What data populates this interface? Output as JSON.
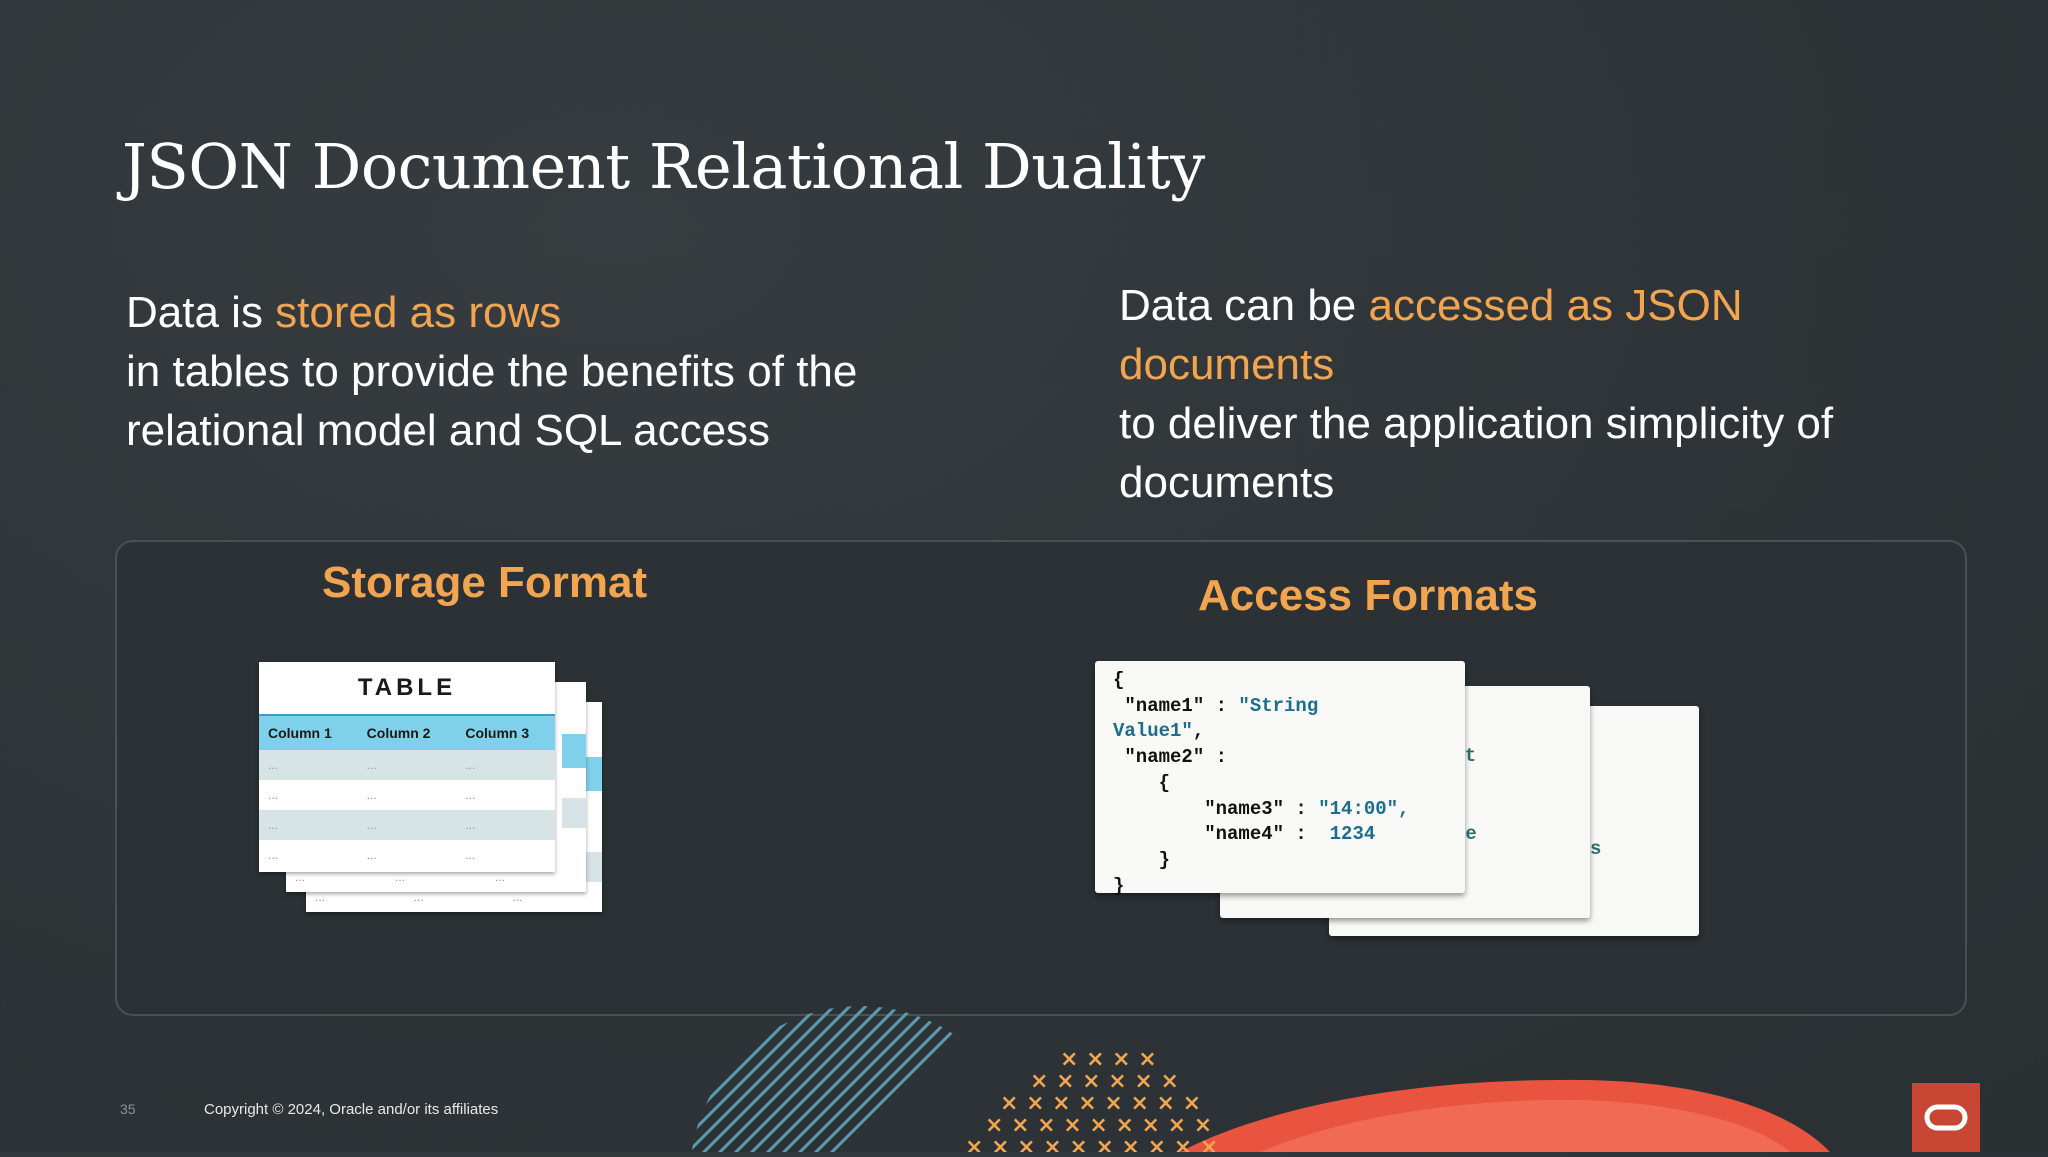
{
  "slide": {
    "title": "JSON Document Relational Duality",
    "left_text": {
      "intro": "Data is ",
      "highlight": "stored as rows",
      "line2": "in tables to provide the benefits of the",
      "line3": "relational model and SQL access"
    },
    "right_text": {
      "intro": "Data can be ",
      "highlight1": "accessed as JSON",
      "highlight2": "documents",
      "line3": "to deliver the application simplicity of",
      "line4": "documents"
    },
    "storage_title": "Storage Format",
    "access_title": "Access Formats",
    "table": {
      "title": "TABLE",
      "columns": [
        "Column 1",
        "Column 2",
        "Column 3"
      ],
      "cell": "..."
    },
    "json": {
      "open_brace": "{",
      "name1_key": " \"name1\" : ",
      "name1_val_a": "\"String",
      "name1_val_b": "Value1\"",
      "comma": ",",
      "name2_key": " \"name2\" :",
      "inner_open": "    {",
      "name3_key": "        \"name3\" : ",
      "name3_val": "\"14:00\",",
      "name4_key": "        \"name4\" :  ",
      "name4_val": "1234",
      "inner_close": "    }",
      "close_brace": "}",
      "peek1": "ent",
      "peek2": "ce",
      "peek3": "s"
    },
    "footer": {
      "page_number": "35",
      "copyright": "Copyright © 2024, Oracle and/or its affiliates"
    },
    "logo_icon": "oracle-logo-icon",
    "colors": {
      "accent": "#f2a550",
      "background": "#2e3437",
      "oracle_red": "#c74634",
      "table_header": "#7fd0ea"
    }
  }
}
